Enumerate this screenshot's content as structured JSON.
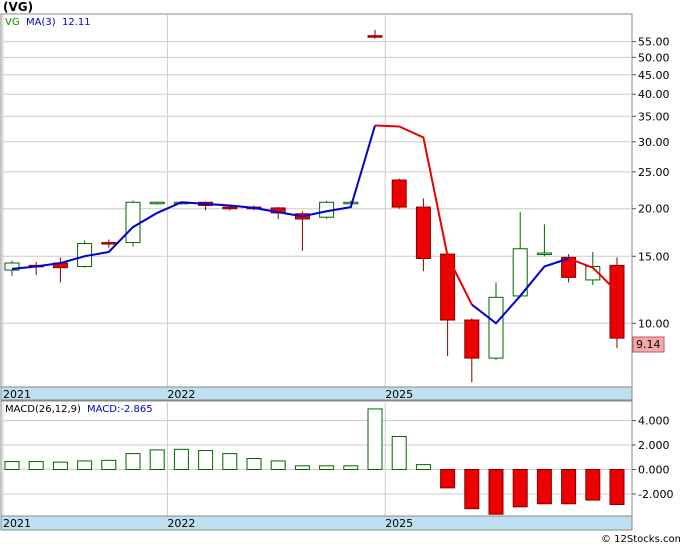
{
  "ticker_title": "(VG)",
  "legend": {
    "symbol": "VG",
    "ma_label": "MA(3)",
    "ma_value": "12.11"
  },
  "price_tag": "9.14",
  "macd_legend": {
    "label": "MACD(26,12,9)",
    "value_label": "MACD:-2.865"
  },
  "watermark": "© 12Stocks.com",
  "colors": {
    "up_body": "#ffffff",
    "up_border": "#006600",
    "down_body": "#ee0000",
    "down_border": "#880000",
    "ma_line_1": "#0000cc",
    "ma_line_2": "#ee0000",
    "axis_band": "#bfe0ee",
    "grid": "#cccccc",
    "legend_symbol": "#008800",
    "legend_ma": "#0000cc",
    "price_tag_bg": "#f4aaaa"
  },
  "chart_data": [
    {
      "type": "candlestick",
      "title": "(VG)",
      "y_scale": "log",
      "ylim": [
        6.8,
        65
      ],
      "y_ticks": [
        10.0,
        15.0,
        20.0,
        25.0,
        30.0,
        35.0,
        40.0,
        45.0,
        50.0,
        55.0
      ],
      "x_labels": [
        "2021",
        "2022",
        "2025"
      ],
      "x_label_candle_index": [
        0,
        7,
        16
      ],
      "candles": [
        {
          "open": 13.8,
          "high": 14.6,
          "low": 13.3,
          "close": 14.4
        },
        {
          "open": 14.2,
          "high": 14.5,
          "low": 13.4,
          "close": 14.1
        },
        {
          "open": 14.4,
          "high": 14.9,
          "low": 12.8,
          "close": 14.0
        },
        {
          "open": 14.1,
          "high": 16.5,
          "low": 14.0,
          "close": 16.2
        },
        {
          "open": 16.3,
          "high": 16.6,
          "low": 15.8,
          "close": 16.2
        },
        {
          "open": 16.3,
          "high": 21.0,
          "low": 15.9,
          "close": 20.8
        },
        {
          "open": 20.7,
          "high": 20.9,
          "low": 20.5,
          "close": 20.8
        },
        {
          "open": 20.7,
          "high": 20.9,
          "low": 20.5,
          "close": 20.8
        },
        {
          "open": 20.8,
          "high": 20.9,
          "low": 19.8,
          "close": 20.4
        },
        {
          "open": 20.2,
          "high": 20.5,
          "low": 19.8,
          "close": 20.0
        },
        {
          "open": 20.2,
          "high": 20.4,
          "low": 19.8,
          "close": 20.0
        },
        {
          "open": 20.1,
          "high": 20.2,
          "low": 18.8,
          "close": 19.5
        },
        {
          "open": 19.4,
          "high": 19.7,
          "low": 15.5,
          "close": 18.8
        },
        {
          "open": 19.0,
          "high": 21.0,
          "low": 18.8,
          "close": 20.8
        },
        {
          "open": 20.8,
          "high": 21.0,
          "low": 20.7,
          "close": 20.8
        },
        {
          "open": 57.0,
          "high": 59.0,
          "low": 56.0,
          "close": 56.5
        },
        {
          "open": 23.8,
          "high": 24.0,
          "low": 20.0,
          "close": 20.2
        },
        {
          "open": 20.2,
          "high": 21.3,
          "low": 13.7,
          "close": 14.8
        },
        {
          "open": 15.2,
          "high": 15.2,
          "low": 8.2,
          "close": 10.2
        },
        {
          "open": 10.2,
          "high": 10.3,
          "low": 7.0,
          "close": 8.1
        },
        {
          "open": 8.1,
          "high": 12.8,
          "low": 8.0,
          "close": 11.7
        },
        {
          "open": 11.8,
          "high": 19.6,
          "low": 11.7,
          "close": 15.7
        },
        {
          "open": 15.3,
          "high": 18.2,
          "low": 15.0,
          "close": 15.3
        },
        {
          "open": 14.9,
          "high": 15.2,
          "low": 12.8,
          "close": 13.2
        },
        {
          "open": 13.0,
          "high": 15.4,
          "low": 12.6,
          "close": 14.1
        },
        {
          "open": 14.2,
          "high": 14.9,
          "low": 8.6,
          "close": 9.14
        }
      ],
      "ma_series": [
        {
          "name": "MA(3)",
          "color": "#0000cc",
          "values": [
            13.9,
            14.1,
            14.4,
            15.0,
            15.4,
            17.9,
            19.5,
            20.8,
            20.6,
            20.4,
            20.1,
            19.6,
            19.1,
            19.7,
            20.2,
            33.1,
            null,
            null,
            null,
            null,
            null,
            null,
            null,
            null,
            null,
            null
          ]
        },
        {
          "name": "MA(3)",
          "color": "#ee0000",
          "values": [
            null,
            null,
            null,
            null,
            null,
            null,
            null,
            null,
            null,
            null,
            null,
            null,
            null,
            null,
            null,
            33.1,
            32.9,
            30.8,
            15.0,
            11.2,
            null,
            null,
            null,
            null,
            null,
            null
          ]
        },
        {
          "name": "MA(3)",
          "color": "#0000cc",
          "values": [
            null,
            null,
            null,
            null,
            null,
            null,
            null,
            null,
            null,
            null,
            null,
            null,
            null,
            null,
            null,
            null,
            null,
            null,
            null,
            11.2,
            10.0,
            11.8,
            14.1,
            14.8,
            null,
            null
          ]
        },
        {
          "name": "MA(3)",
          "color": "#ee0000",
          "values": [
            null,
            null,
            null,
            null,
            null,
            null,
            null,
            null,
            null,
            null,
            null,
            null,
            null,
            null,
            null,
            null,
            null,
            null,
            null,
            null,
            null,
            null,
            null,
            14.8,
            14.0,
            12.11
          ]
        }
      ]
    },
    {
      "type": "bar",
      "title": "MACD(26,12,9)",
      "ylim": [
        -3.8,
        5.6
      ],
      "y_ticks": [
        4.0,
        2.0,
        0.0,
        -2.0
      ],
      "y_tick_labels": [
        "4.000",
        "2.000",
        "0.000",
        "-2.000"
      ],
      "x_labels": [
        "2021",
        "2022",
        "2025"
      ],
      "values": [
        0.65,
        0.65,
        0.6,
        0.7,
        0.75,
        1.3,
        1.6,
        1.65,
        1.55,
        1.3,
        0.9,
        0.7,
        0.3,
        0.3,
        0.3,
        4.95,
        2.7,
        0.4,
        -1.5,
        -3.2,
        -3.65,
        -3.05,
        -2.8,
        -2.8,
        -2.5,
        -2.865
      ]
    }
  ]
}
